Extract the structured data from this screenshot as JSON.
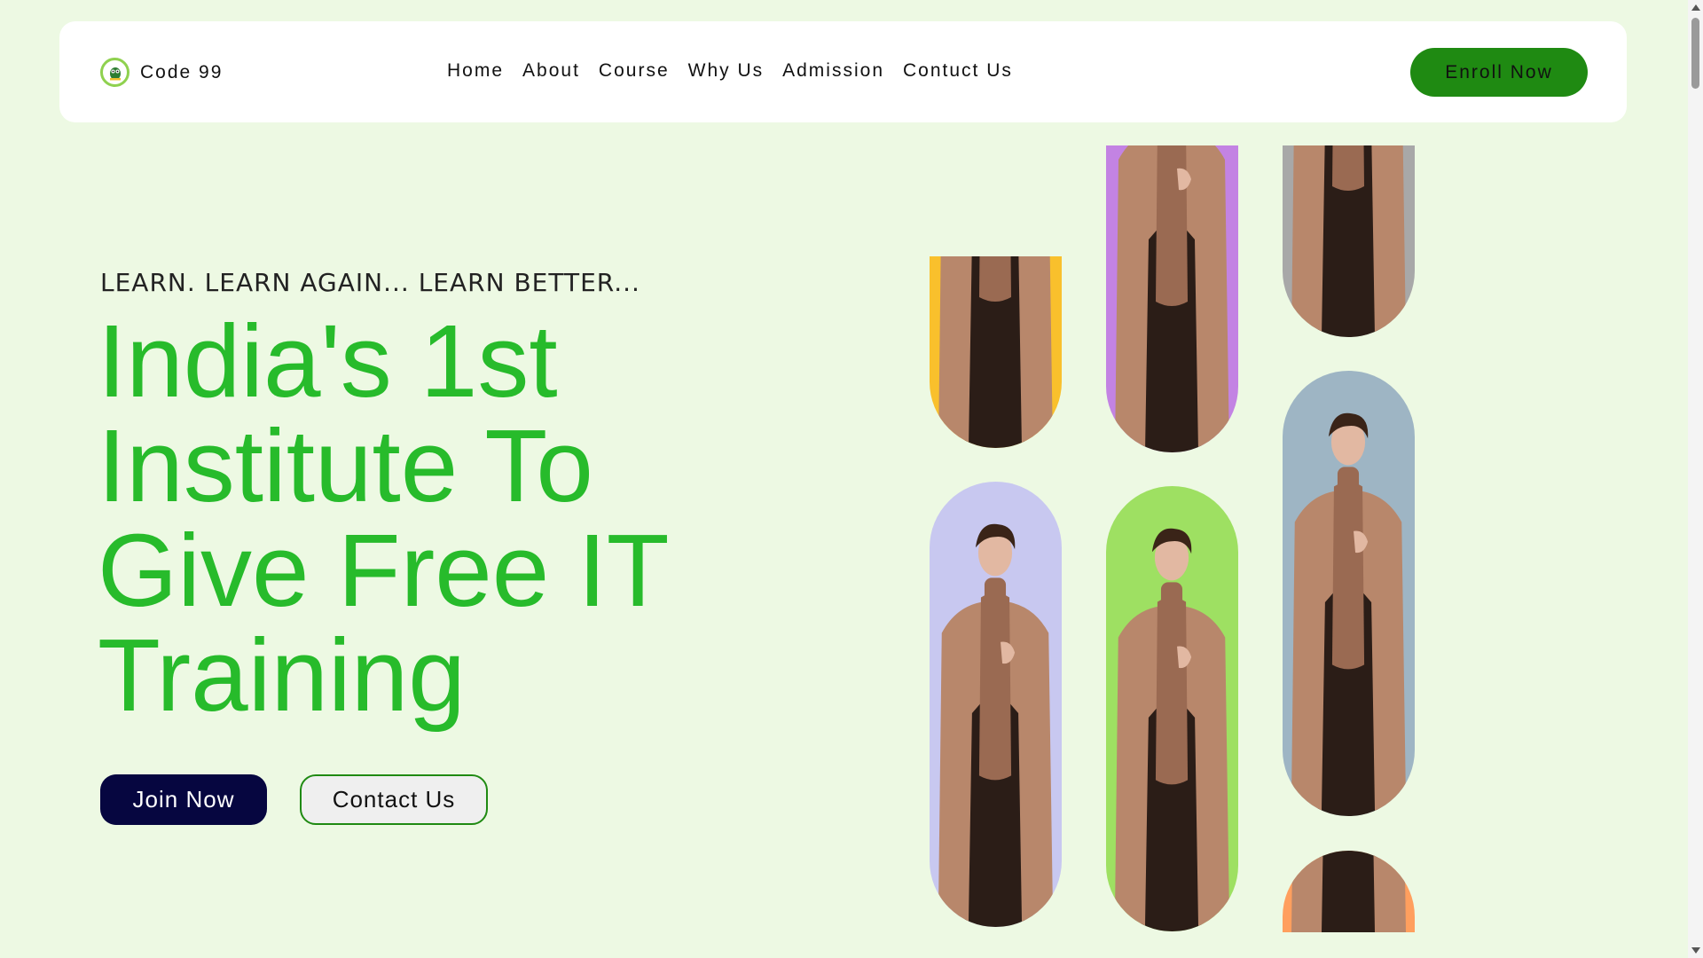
{
  "nav": {
    "brand": "Code 99",
    "logo_icon": "owl-logo-icon",
    "links": [
      "Home",
      "About",
      "Course",
      "Why Us",
      "Admission",
      "Contuct Us"
    ],
    "cta": "Enroll Now"
  },
  "hero": {
    "tagline": "LEARN. LEARN AGAIN... LEARN BETTER...",
    "headline": "India's 1st Institute To Give Free IT Training",
    "join_button": "Join Now",
    "contact_button": "Contact Us"
  },
  "gallery": {
    "image_name": "man-in-coat-photo",
    "backgrounds": [
      "#f9c02c",
      "#c383e3",
      "#a8a8a8",
      "#c8c8f0",
      "#9ee062",
      "#9eb5c4",
      "#ff9f5e"
    ]
  },
  "colors": {
    "page_bg": "#edf9e3",
    "accent_green": "#27bb2b",
    "button_green": "#1f8a12",
    "navy": "#060640"
  }
}
